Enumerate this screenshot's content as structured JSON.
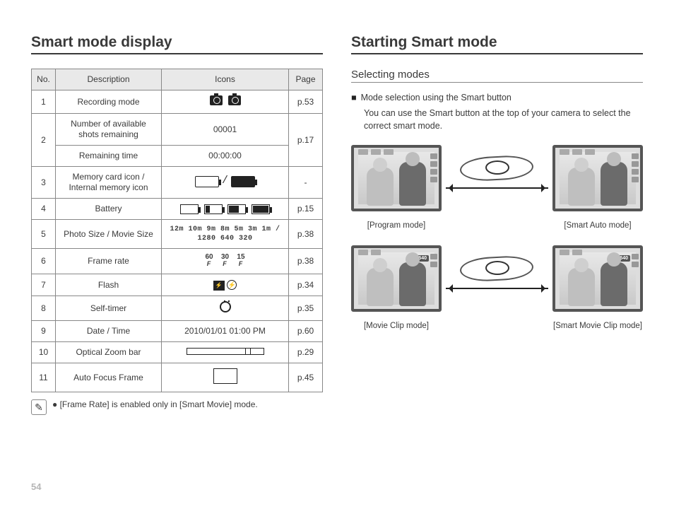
{
  "page_number": "54",
  "left": {
    "heading": "Smart mode display",
    "table": {
      "headers": {
        "no": "No.",
        "desc": "Description",
        "icons": "Icons",
        "page": "Page"
      },
      "rows": [
        {
          "no": "1",
          "desc": "Recording mode",
          "page": "p.53",
          "icon_type": "recmode"
        },
        {
          "no": "2",
          "desc_a": "Number of available shots remaining",
          "icon_a": "00001",
          "desc_b": "Remaining time",
          "icon_b": "00:00:00",
          "page": "p.17",
          "icon_type": "text_merged"
        },
        {
          "no": "3",
          "desc": "Memory card icon / Internal memory icon",
          "page": "-",
          "icon_type": "memory"
        },
        {
          "no": "4",
          "desc": "Battery",
          "page": "p.15",
          "icon_type": "battery"
        },
        {
          "no": "5",
          "desc": "Photo Size / Movie Size",
          "page": "p.38",
          "icon_type": "photosize",
          "icon_text_top": "12m 10m 9m 8m 5m 3m 1m /",
          "icon_text_bot": "1280 640 320"
        },
        {
          "no": "6",
          "desc": "Frame rate",
          "page": "p.38",
          "icon_type": "framerate",
          "fr": [
            "60",
            "30",
            "15"
          ]
        },
        {
          "no": "7",
          "desc": "Flash",
          "page": "p.34",
          "icon_type": "flash"
        },
        {
          "no": "8",
          "desc": "Self-timer",
          "page": "p.35",
          "icon_type": "timer"
        },
        {
          "no": "9",
          "desc": "Date / Time",
          "page": "p.60",
          "icon_type": "text",
          "icon_text": "2010/01/01  01:00 PM"
        },
        {
          "no": "10",
          "desc": "Optical Zoom bar",
          "page": "p.29",
          "icon_type": "zoom"
        },
        {
          "no": "11",
          "desc": "Auto Focus Frame",
          "page": "p.45",
          "icon_type": "afbox"
        }
      ]
    },
    "note_bullet": "●",
    "note": "[Frame Rate] is enabled only in [Smart Movie] mode."
  },
  "right": {
    "heading": "Starting Smart mode",
    "subheading": "Selecting modes",
    "bullet_marker": "■",
    "bullet_text": "Mode selection using the Smart button",
    "body": "You can use the Smart button at the top of your camera to select the correct smart mode.",
    "modes": {
      "program": "[Program mode]",
      "smart_auto": "[Smart Auto mode]",
      "movie": "[Movie Clip mode]",
      "smart_movie": "[Smart Movie Clip mode]",
      "res_label": "640"
    }
  }
}
